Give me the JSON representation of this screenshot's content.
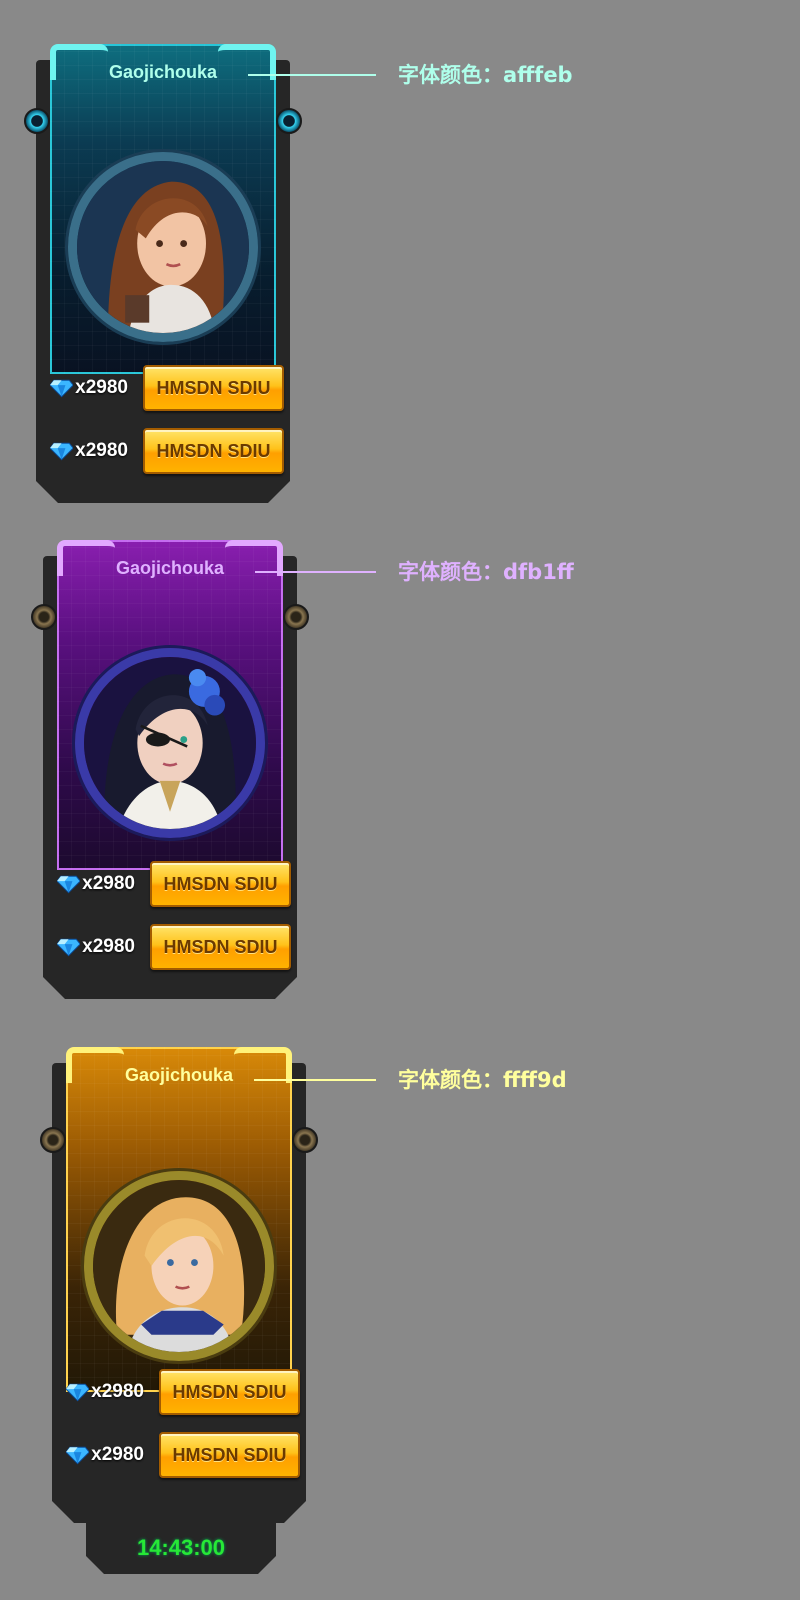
{
  "cards": [
    {
      "title": "Gaojichouka",
      "theme": "blue",
      "title_color": "#afffeb",
      "note": "字体颜色：afffeb",
      "offers": [
        {
          "price": "x2980",
          "button": "HMSDN SDIU"
        },
        {
          "price": "x2980",
          "button": "HMSDN SDIU"
        }
      ]
    },
    {
      "title": "Gaojichouka",
      "theme": "purple",
      "title_color": "#dfb1ff",
      "note": "字体颜色：dfb1ff",
      "offers": [
        {
          "price": "x2980",
          "button": "HMSDN SDIU"
        },
        {
          "price": "x2980",
          "button": "HMSDN SDIU"
        }
      ]
    },
    {
      "title": "Gaojichouka",
      "theme": "gold",
      "title_color": "#ffff9d",
      "note": "字体颜色：ffff9d",
      "offers": [
        {
          "price": "x2980",
          "button": "HMSDN SDIU"
        },
        {
          "price": "x2980",
          "button": "HMSDN SDIU"
        }
      ],
      "timer": "14:43:00"
    }
  ],
  "icons": [
    "gem-icon",
    "portrait-image"
  ]
}
